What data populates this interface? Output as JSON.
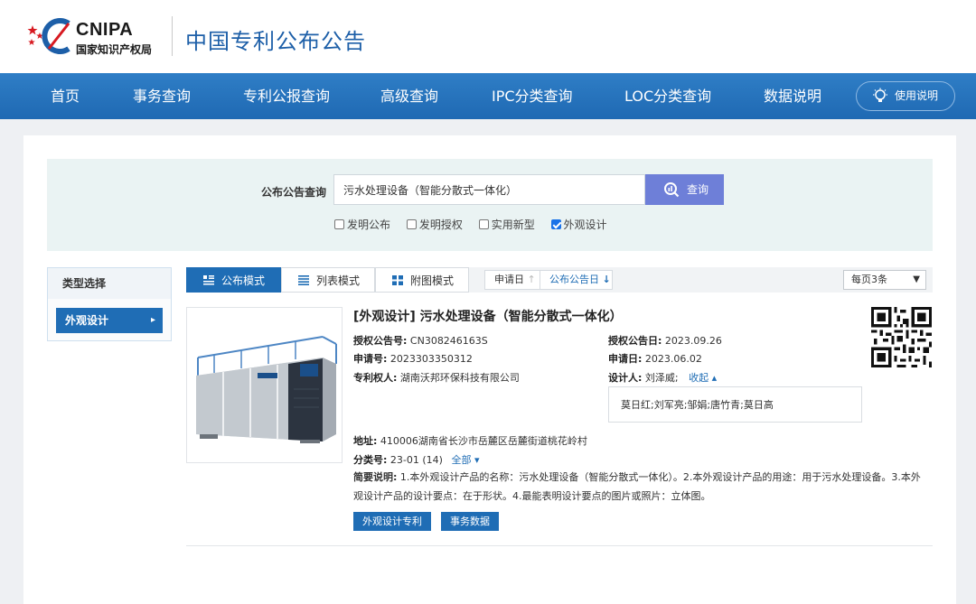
{
  "header": {
    "logo_text": "CNIPA",
    "logo_subtitle": "国家知识产权局",
    "site_title": "中国专利公布公告"
  },
  "nav": {
    "items": [
      "首页",
      "事务查询",
      "专利公报查询",
      "高级查询",
      "IPC分类查询",
      "LOC分类查询",
      "数据说明"
    ],
    "help_label": "使用说明"
  },
  "search": {
    "label": "公布公告查询",
    "query": "污水处理设备（智能分散式一体化）",
    "button_label": "查询",
    "filters": [
      {
        "label": "发明公布",
        "checked": false
      },
      {
        "label": "发明授权",
        "checked": false
      },
      {
        "label": "实用新型",
        "checked": false
      },
      {
        "label": "外观设计",
        "checked": true
      }
    ]
  },
  "sidebar": {
    "heading": "类型选择",
    "items": [
      "外观设计"
    ]
  },
  "modes": {
    "items": [
      "公布模式",
      "列表模式",
      "附图模式"
    ],
    "active": "公布模式",
    "sort_apply": "申请日",
    "sort_publish": "公布公告日",
    "per_page": "每页3条"
  },
  "result": {
    "title": "[外观设计] 污水处理设备（智能分散式一体化）",
    "grant_no_label": "授权公告号:",
    "grant_no": "CN308246163S",
    "grant_date_label": "授权公告日:",
    "grant_date": "2023.09.26",
    "app_no_label": "申请号:",
    "app_no": "2023303350312",
    "app_date_label": "申请日:",
    "app_date": "2023.06.02",
    "holder_label": "专利权人:",
    "holder": "湖南沃邦环保科技有限公司",
    "designer_label": "设计人:",
    "designer_first": "刘泽威;",
    "collapse_label": "收起 ▴",
    "designers_more": "莫日红;刘军亮;邹娟;唐竹青;莫日高",
    "address_label": "地址:",
    "address": "410006湖南省长沙市岳麓区岳麓街道桃花岭村",
    "class_label": "分类号:",
    "class_no": "23-01 (14)",
    "class_all": "全部 ▾",
    "summary_label": "简要说明:",
    "summary": "1.本外观设计产品的名称：污水处理设备（智能分散式一体化）。2.本外观设计产品的用途：用于污水处理设备。3.本外观设计产品的设计要点：在于形状。4.最能表明设计要点的图片或照片：立体图。",
    "btn_design": "外观设计专利",
    "btn_affairs": "事务数据"
  },
  "colors": {
    "nav_blue": "#1f69b3",
    "title_blue": "#1d5fa8",
    "search_button": "#6e7fd8",
    "accent": "#1f6db5"
  }
}
